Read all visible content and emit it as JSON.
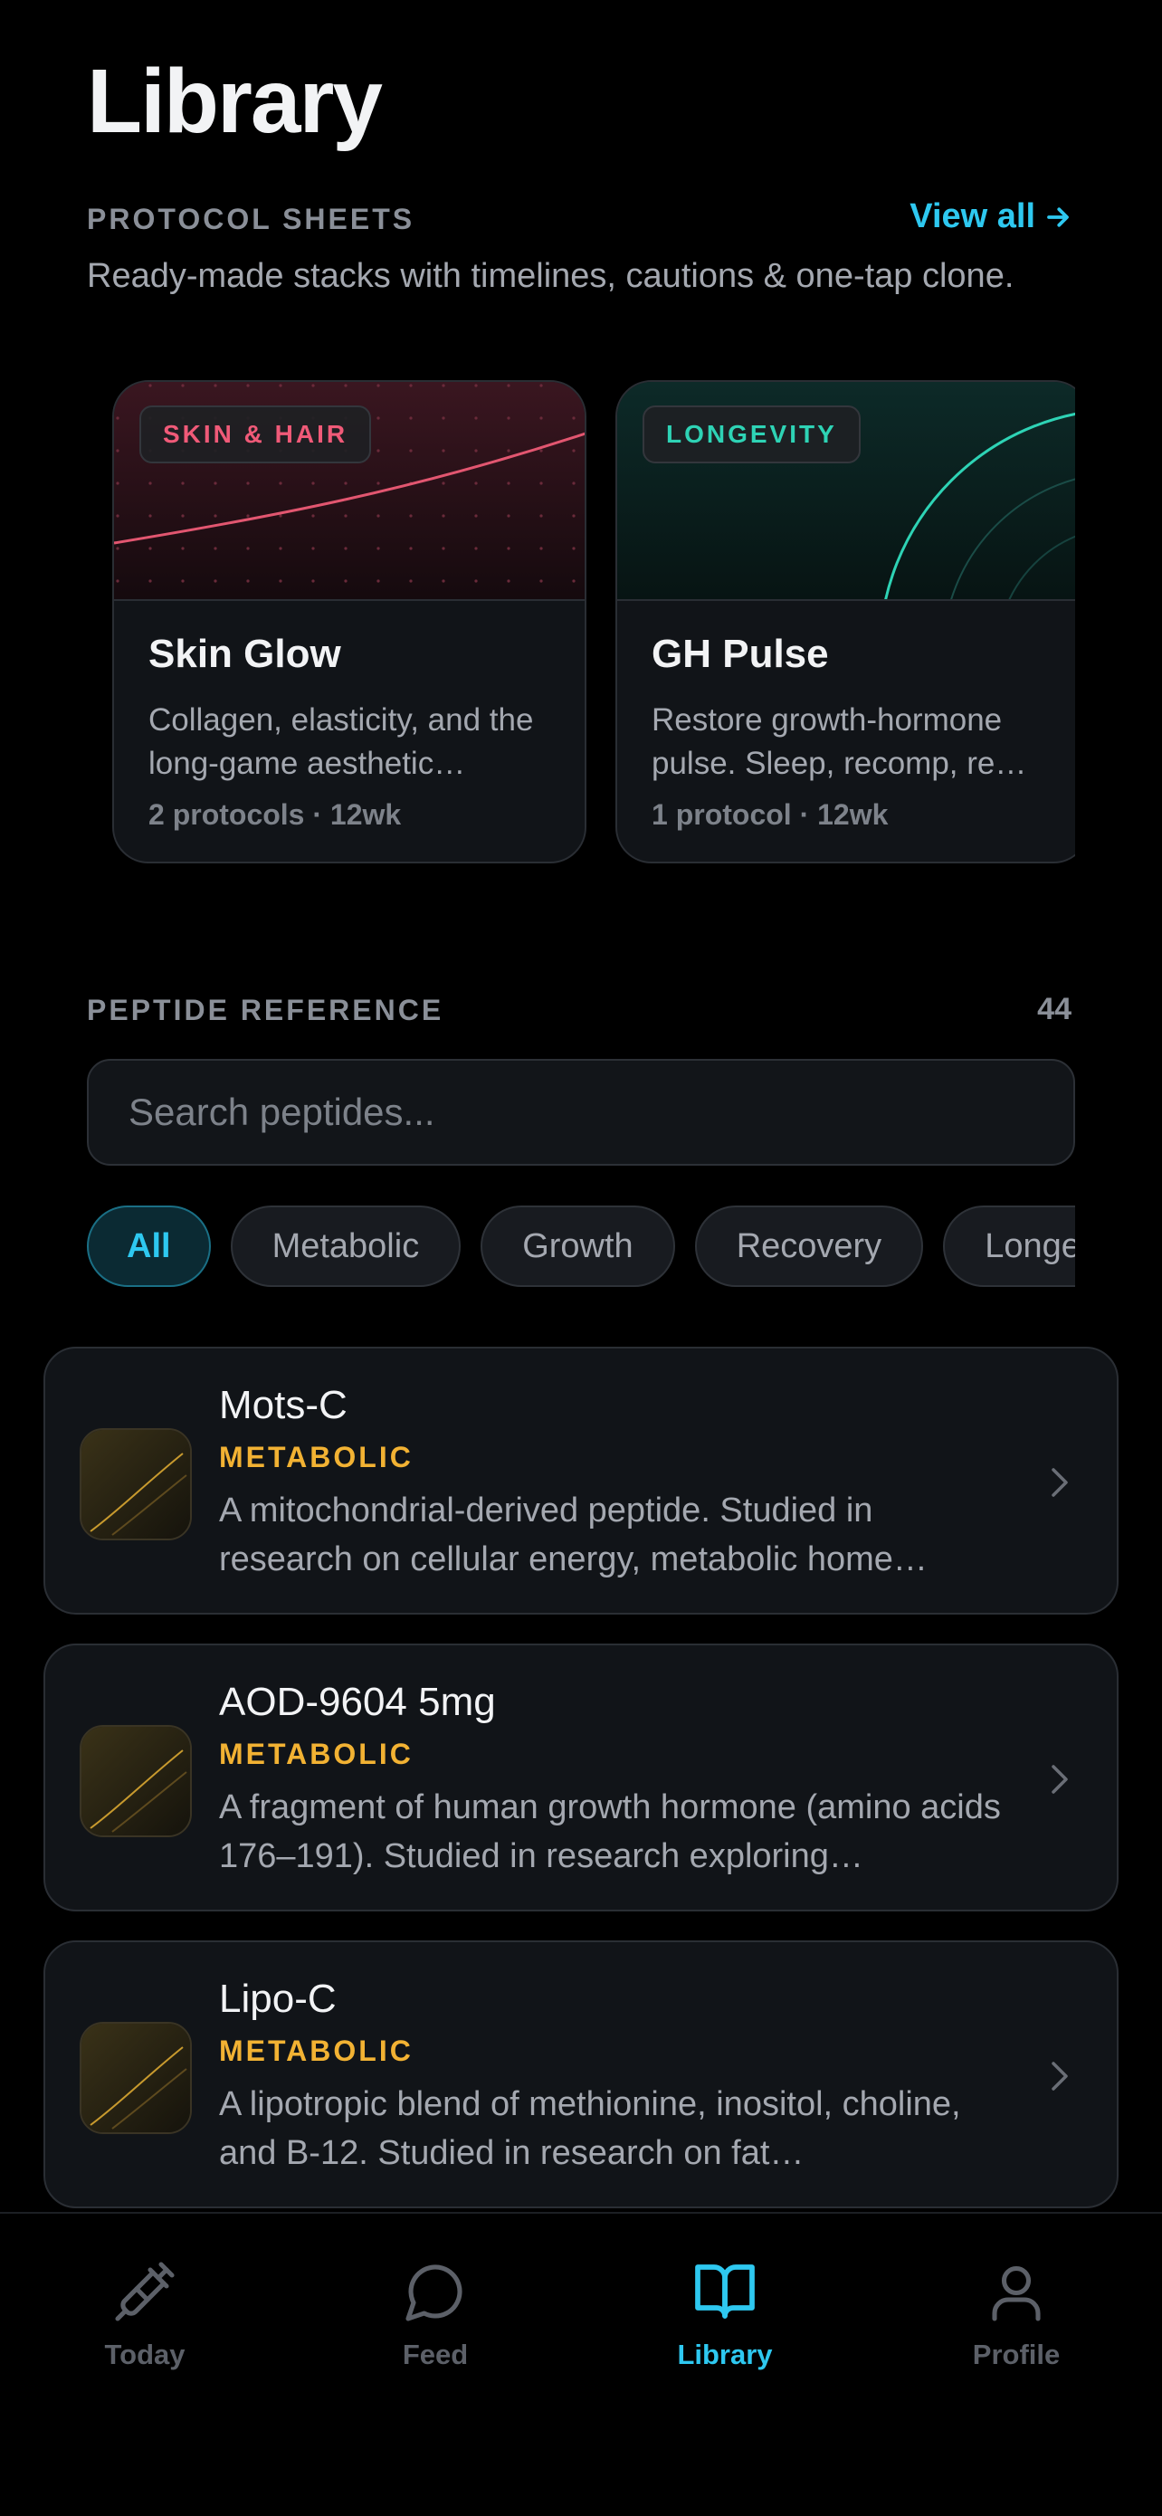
{
  "page": {
    "title": "Library"
  },
  "protocol_sheets": {
    "label": "PROTOCOL SHEETS",
    "view_all": "View all",
    "description": "Ready-made stacks with timelines, cautions & one-tap clone.",
    "cards": [
      {
        "tag": "SKIN & HAIR",
        "tag_color": "#f05a78",
        "title": "Skin Glow",
        "description": "Collagen, elasticity, and the long-game aesthetic…",
        "meta": "2 protocols · 12wk"
      },
      {
        "tag": "LONGEVITY",
        "tag_color": "#2ed3b5",
        "title": "GH Pulse",
        "description": "Restore growth-hormone pulse. Sleep, recomp, re…",
        "meta": "1 protocol · 12wk"
      }
    ]
  },
  "peptide_reference": {
    "label": "PEPTIDE REFERENCE",
    "count": "44",
    "search_placeholder": "Search peptides...",
    "filters": [
      "All",
      "Metabolic",
      "Growth",
      "Recovery",
      "Longevity"
    ],
    "active_filter": "All",
    "items": [
      {
        "name": "Mots-C",
        "category": "METABOLIC",
        "description": "A mitochondrial-derived peptide. Studied in research on cellular energy, metabolic home…"
      },
      {
        "name": "AOD-9604 5mg",
        "category": "METABOLIC",
        "description": "A fragment of human growth hormone (amino acids 176–191). Studied in research exploring…"
      },
      {
        "name": "Lipo-C",
        "category": "METABOLIC",
        "description": "A lipotropic blend of methionine, inositol, choline, and B-12. Studied in research on fat…"
      }
    ]
  },
  "tab_bar": {
    "tabs": [
      {
        "label": "Today",
        "icon": "syringe-icon"
      },
      {
        "label": "Feed",
        "icon": "chat-bubble-icon"
      },
      {
        "label": "Library",
        "icon": "book-icon"
      },
      {
        "label": "Profile",
        "icon": "person-icon"
      }
    ],
    "active": "Library"
  },
  "colors": {
    "accent": "#2ec8f0",
    "metabolic": "#f2b233",
    "background": "#000000",
    "card": "#111418"
  }
}
